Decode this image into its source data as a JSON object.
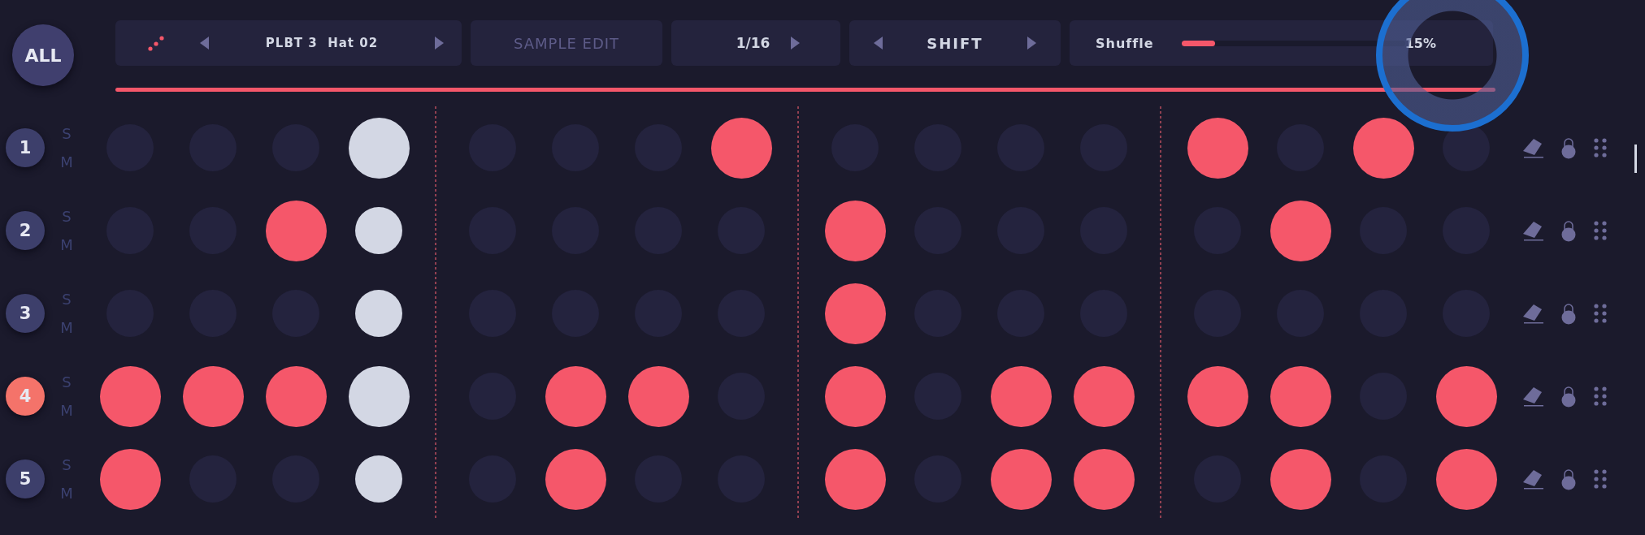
{
  "all_button": {
    "label": "ALL"
  },
  "toolbar": {
    "sample": {
      "name": "PLBT 3  Hat 02"
    },
    "sample_edit": {
      "label": "SAMPLE EDIT",
      "disabled": true
    },
    "resolution": {
      "value": "1/16"
    },
    "shift": {
      "label": "SHIFT"
    },
    "shuffle": {
      "label": "Shuffle",
      "level": 0.15,
      "reading": "15%"
    }
  },
  "columns": [
    {
      "selected": false
    },
    {
      "selected": false
    },
    {
      "selected": false
    },
    {
      "selected": true
    },
    {
      "selected": false
    },
    {
      "selected": false
    },
    {
      "selected": false
    },
    {
      "selected": false
    },
    {
      "selected": false
    },
    {
      "selected": false
    },
    {
      "selected": false
    },
    {
      "selected": false
    },
    {
      "selected": false
    },
    {
      "selected": false
    },
    {
      "selected": false
    },
    {
      "selected": false
    }
  ],
  "tracks": [
    {
      "number": "1",
      "selected": false,
      "solo": "S",
      "mute": "M",
      "steps": [
        false,
        false,
        false,
        true,
        false,
        false,
        false,
        true,
        false,
        false,
        false,
        false,
        true,
        false,
        true,
        false
      ]
    },
    {
      "number": "2",
      "selected": false,
      "solo": "S",
      "mute": "M",
      "steps": [
        false,
        false,
        true,
        false,
        false,
        false,
        false,
        false,
        true,
        false,
        false,
        false,
        false,
        true,
        false,
        false
      ]
    },
    {
      "number": "3",
      "selected": false,
      "solo": "S",
      "mute": "M",
      "steps": [
        false,
        false,
        false,
        false,
        false,
        false,
        false,
        false,
        true,
        false,
        false,
        false,
        false,
        false,
        false,
        false
      ]
    },
    {
      "number": "4",
      "selected": true,
      "solo": "S",
      "mute": "M",
      "steps": [
        true,
        true,
        true,
        true,
        false,
        true,
        true,
        false,
        true,
        false,
        true,
        true,
        true,
        true,
        false,
        true
      ]
    },
    {
      "number": "5",
      "selected": false,
      "solo": "S",
      "mute": "M",
      "steps": [
        true,
        false,
        false,
        false,
        false,
        true,
        false,
        false,
        true,
        false,
        true,
        true,
        false,
        true,
        false,
        true
      ]
    }
  ]
}
